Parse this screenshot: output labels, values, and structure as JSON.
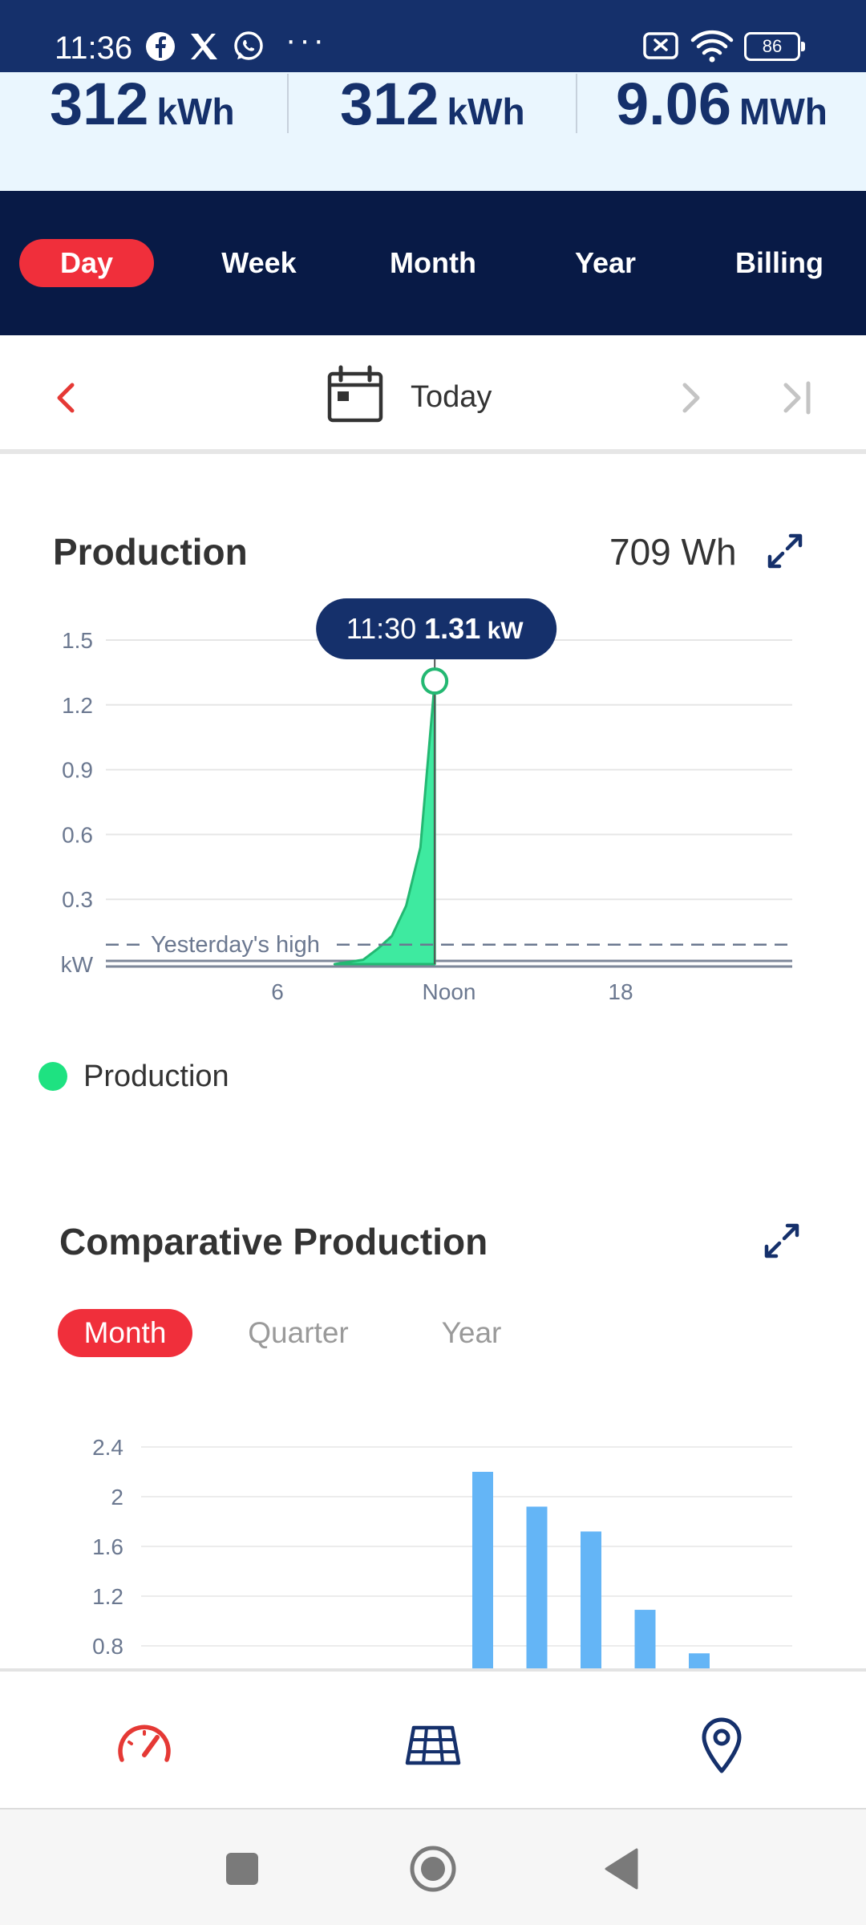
{
  "status_bar": {
    "time": "11:36",
    "notification_icons": [
      "facebook-icon",
      "x-icon",
      "whatsapp-icon"
    ],
    "more": "···",
    "battery": "86"
  },
  "summary": {
    "stats": [
      {
        "value": "312",
        "unit": "kWh"
      },
      {
        "value": "312",
        "unit": "kWh"
      },
      {
        "value": "9.06",
        "unit": "MWh"
      }
    ]
  },
  "period_tabs": {
    "items": [
      "Day",
      "Week",
      "Month",
      "Year",
      "Billing"
    ],
    "active": "Day"
  },
  "date_nav": {
    "label": "Today"
  },
  "production": {
    "title": "Production",
    "total": "709 Wh",
    "legend": "Production"
  },
  "comparative": {
    "title": "Comparative Production",
    "tabs": [
      "Month",
      "Quarter",
      "Year"
    ],
    "active": "Month"
  },
  "colors": {
    "accent_red": "#f02f3b",
    "navy": "#081a46",
    "header_blue": "#15306b",
    "production_green": "#1ee281",
    "bar_blue": "#64b5f6"
  },
  "chart_data": [
    {
      "type": "area",
      "title": "Production",
      "ylabel": "kW",
      "yticks": [
        "1.5",
        "1.2",
        "0.9",
        "0.6",
        "0.3",
        "kW"
      ],
      "ytick_values": [
        1.5,
        1.2,
        0.9,
        0.6,
        0.3,
        0
      ],
      "ylim": [
        0,
        1.5
      ],
      "xlim": [
        0,
        24
      ],
      "xticks": [
        {
          "value": 6,
          "label": "6"
        },
        {
          "value": 12,
          "label": "Noon"
        },
        {
          "value": 18,
          "label": "18"
        }
      ],
      "series": [
        {
          "name": "Production",
          "color": "#1ee281",
          "points": [
            [
              8,
              0
            ],
            [
              9,
              0.02
            ],
            [
              9.5,
              0.07
            ],
            [
              10,
              0.13
            ],
            [
              10.5,
              0.27
            ],
            [
              11,
              0.54
            ],
            [
              11.5,
              1.31
            ]
          ]
        }
      ],
      "reference": {
        "label": "Yesterday's high",
        "value": 0.09
      },
      "tooltip": {
        "time": "11:30",
        "value": "1.31",
        "unit": "kW",
        "x": 11.5,
        "y": 1.31
      },
      "grid": true
    },
    {
      "type": "bar",
      "title": "Comparative Production",
      "yticks": [
        "2.4",
        "2",
        "1.6",
        "1.2",
        "0.8"
      ],
      "ytick_values": [
        2.4,
        2.0,
        1.6,
        1.2,
        0.8
      ],
      "ylim_visible": [
        0.8,
        2.4
      ],
      "bar_values": [
        2.2,
        1.92,
        1.72,
        1.09,
        0.74
      ],
      "bar_slots": [
        6,
        7,
        8,
        9,
        10
      ],
      "slot_count": 12,
      "color": "#64b5f6",
      "grid": true
    }
  ]
}
